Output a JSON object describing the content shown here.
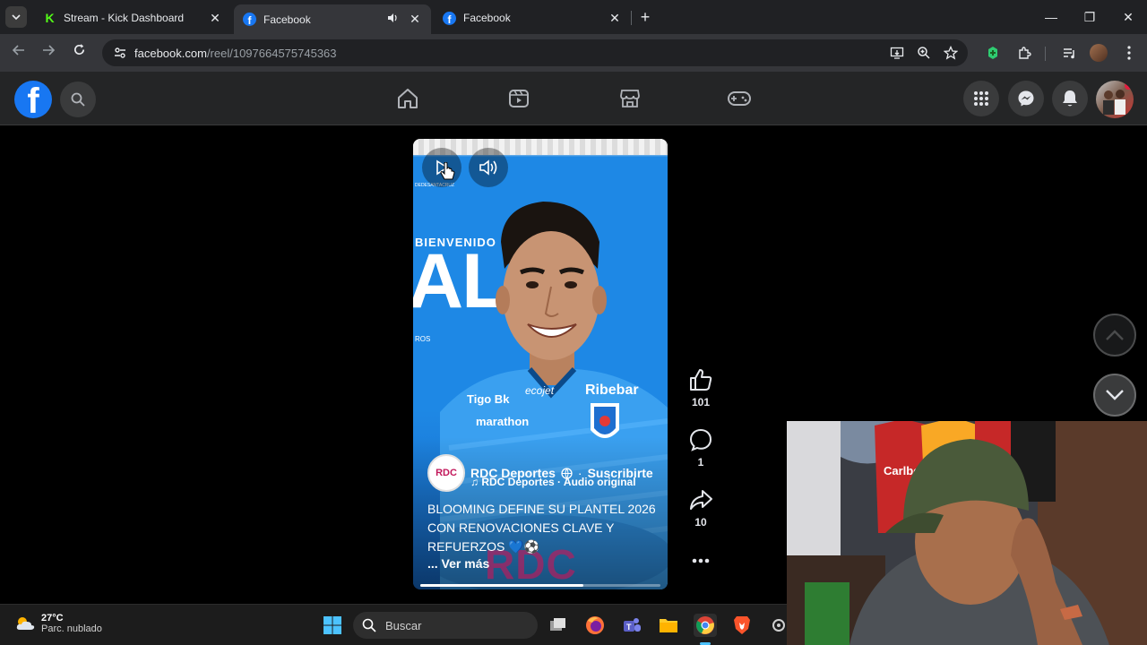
{
  "browser": {
    "tabs": [
      {
        "title": "Stream - Kick Dashboard",
        "favicon": "kick-icon"
      },
      {
        "title": "Facebook",
        "favicon": "facebook-icon",
        "audio": true
      },
      {
        "title": "Facebook",
        "favicon": "facebook-icon"
      }
    ],
    "url_host": "facebook.com",
    "url_path": "/reel/1097664575745363"
  },
  "reel": {
    "overlay_text": {
      "bienvenido": "BIENVENIDO",
      "big": "ALLI",
      "ros": "ROS",
      "brand_small": "DEDESANTACRUZ"
    },
    "author_avatar_text": "RDC",
    "author": "RDC Deportes",
    "subscribe": "Suscribirte",
    "audio": "RDC Deportes · Audio original",
    "caption": "BLOOMING DEFINE SU PLANTEL 2026 CON RENOVACIONES CLAVE Y REFUERZOS 💙⚽",
    "see_more": "... Ver más",
    "watermark": "RDC",
    "progress": 0.68
  },
  "actions": {
    "likes": "101",
    "comments": "1",
    "shares": "10"
  },
  "taskbar": {
    "temp": "27°C",
    "weather": "Parc. nublado",
    "search": "Buscar"
  },
  "colors": {
    "facebook_blue": "#1877f2",
    "reel_blue": "#1e88e5",
    "dark_bg": "#242526"
  }
}
